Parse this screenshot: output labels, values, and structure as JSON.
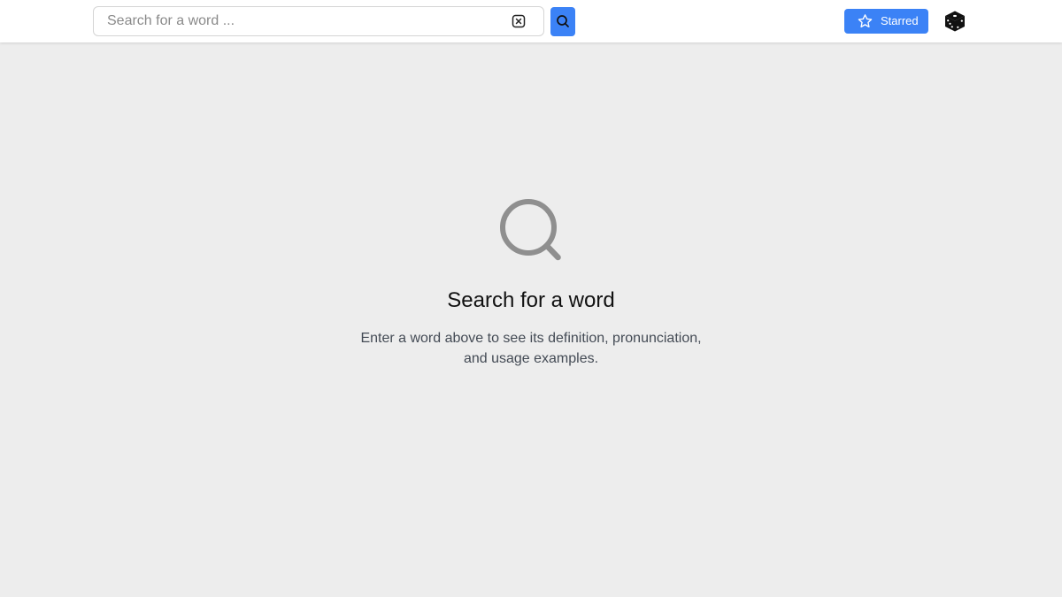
{
  "search": {
    "placeholder": "Search for a word ...",
    "value": ""
  },
  "header": {
    "starred_label": "Starred"
  },
  "empty_state": {
    "title": "Search for a word",
    "description": "Enter a word above to see its definition, pronunciation, and usage examples."
  },
  "icons": {
    "clear": "clear-icon",
    "search": "search-icon",
    "star": "star-icon",
    "dice": "dice-icon",
    "magnifier": "magnifier-icon"
  },
  "colors": {
    "accent": "#3b82f6",
    "background": "#ededed",
    "topbar": "#ffffff",
    "icon_gray": "#8f8f8f"
  }
}
